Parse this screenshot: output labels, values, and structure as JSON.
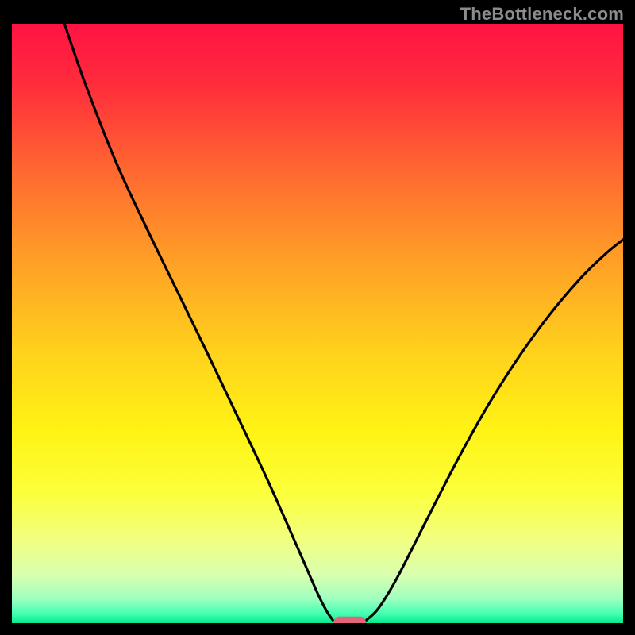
{
  "watermark": "TheBottleneck.com",
  "chart_data": {
    "type": "line",
    "title": "",
    "xlabel": "",
    "ylabel": "",
    "xlim": [
      0,
      1
    ],
    "ylim": [
      0,
      1
    ],
    "gradient_stops": [
      {
        "offset": 0.0,
        "color": "#ff1344"
      },
      {
        "offset": 0.1,
        "color": "#ff2c3c"
      },
      {
        "offset": 0.25,
        "color": "#ff6a30"
      },
      {
        "offset": 0.4,
        "color": "#ffa126"
      },
      {
        "offset": 0.55,
        "color": "#ffd21c"
      },
      {
        "offset": 0.68,
        "color": "#fff314"
      },
      {
        "offset": 0.78,
        "color": "#fcff3a"
      },
      {
        "offset": 0.86,
        "color": "#f2ff80"
      },
      {
        "offset": 0.92,
        "color": "#d8ffb0"
      },
      {
        "offset": 0.96,
        "color": "#9effc0"
      },
      {
        "offset": 0.985,
        "color": "#40ffb0"
      },
      {
        "offset": 1.0,
        "color": "#05e88f"
      }
    ],
    "series": [
      {
        "name": "left-branch",
        "x": [
          0.086,
          0.12,
          0.17,
          0.22,
          0.27,
          0.32,
          0.37,
          0.42,
          0.47,
          0.5,
          0.515,
          0.525
        ],
        "y": [
          1.0,
          0.9,
          0.77,
          0.66,
          0.555,
          0.45,
          0.343,
          0.235,
          0.12,
          0.05,
          0.02,
          0.005
        ]
      },
      {
        "name": "right-branch",
        "x": [
          0.58,
          0.6,
          0.63,
          0.68,
          0.73,
          0.78,
          0.83,
          0.88,
          0.93,
          0.97,
          1.0
        ],
        "y": [
          0.005,
          0.025,
          0.075,
          0.175,
          0.274,
          0.365,
          0.445,
          0.515,
          0.575,
          0.615,
          0.64
        ]
      }
    ],
    "marker": {
      "center_x": 0.553,
      "center_y": 0.002,
      "width": 0.052,
      "height": 0.018,
      "rx": 0.009,
      "color": "#e4647a"
    }
  }
}
